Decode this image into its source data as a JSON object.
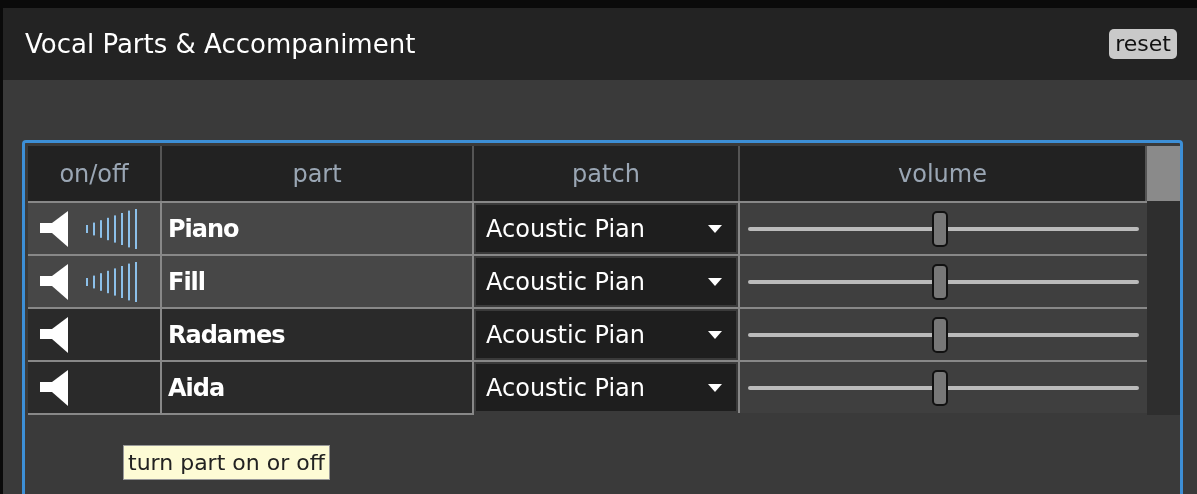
{
  "panel": {
    "title": "Vocal Parts & Accompaniment",
    "reset_button": "reset"
  },
  "table": {
    "columns": [
      "on/off",
      "part",
      "patch",
      "volume"
    ],
    "rows": [
      {
        "on": true,
        "part": "Piano",
        "patch": "Acoustic Pian",
        "level": 0.49
      },
      {
        "on": true,
        "part": "Fill",
        "patch": "Acoustic Pian",
        "level": 0.49
      },
      {
        "on": false,
        "part": "Radames",
        "patch": "Acoustic Pian",
        "level": 0.49
      },
      {
        "on": false,
        "part": "Aida",
        "patch": "Acoustic Pian",
        "level": 0.49
      }
    ]
  },
  "tooltip": "turn part on or off"
}
